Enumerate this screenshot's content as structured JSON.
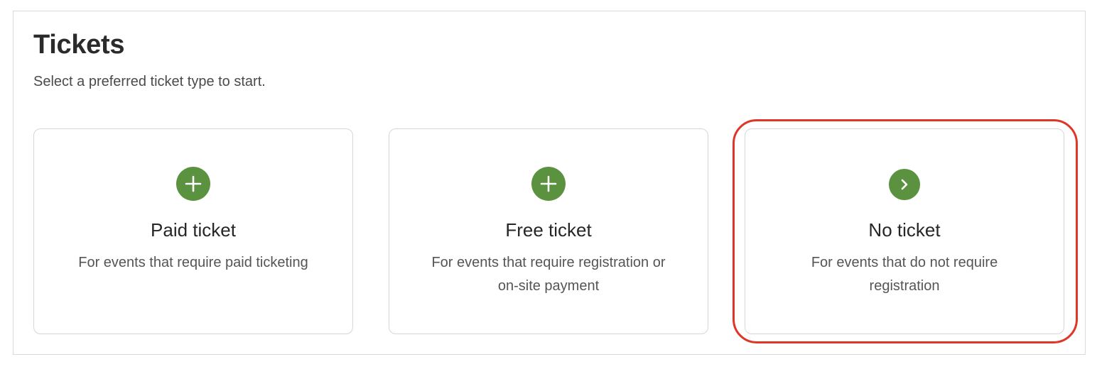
{
  "header": {
    "title": "Tickets",
    "subtitle": "Select a preferred ticket type to start."
  },
  "cards": [
    {
      "title": "Paid ticket",
      "description": "For events that require paid ticketing",
      "icon": "plus-circle-icon"
    },
    {
      "title": "Free ticket",
      "description": "For events that require registration or on-site payment",
      "icon": "plus-circle-icon"
    },
    {
      "title": "No ticket",
      "description": "For events that do not require registration",
      "icon": "chevron-right-circle-icon"
    }
  ],
  "colors": {
    "icon_green": "#5b9240",
    "highlight_red": "#e03628",
    "border": "#d6d6d6"
  }
}
